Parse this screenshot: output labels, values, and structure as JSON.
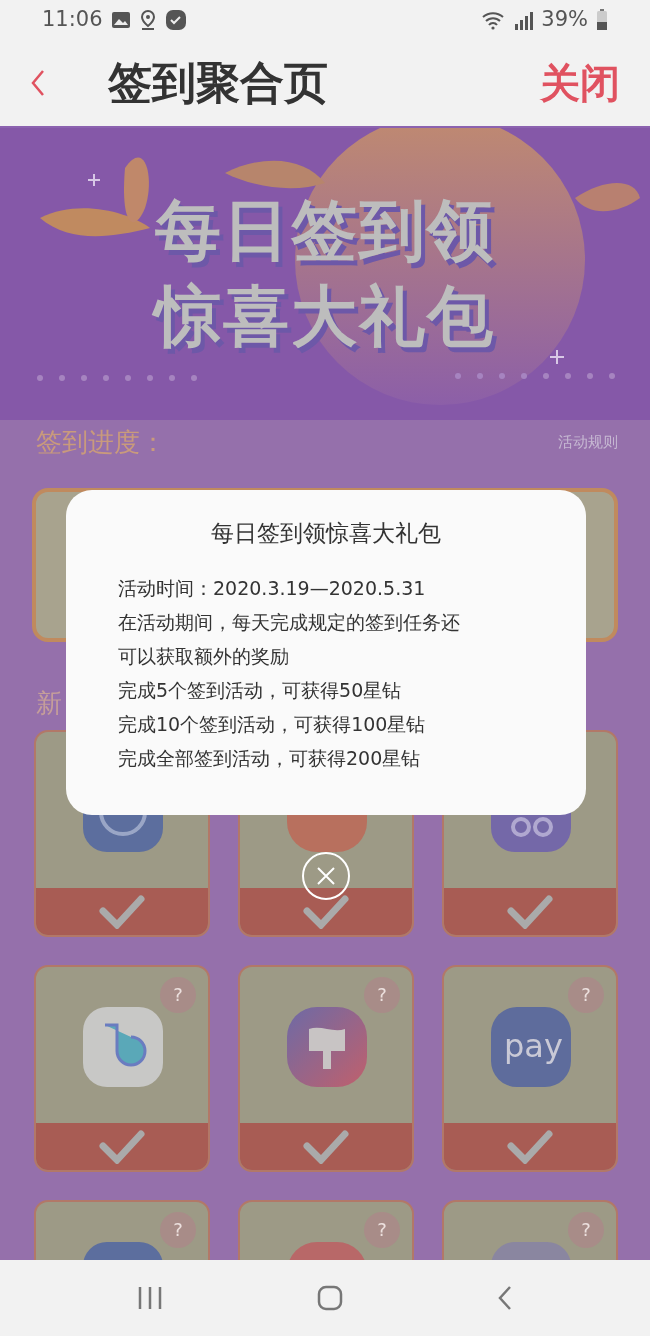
{
  "status_bar": {
    "time": "11:06",
    "battery": "39%"
  },
  "header": {
    "title": "签到聚合页",
    "close": "关闭"
  },
  "banner": {
    "title_lines": [
      "每日签到领",
      "惊喜大礼包"
    ]
  },
  "progress": {
    "label": "签到进度：",
    "rules_link": "活动规则"
  },
  "section_title": "新",
  "tasks": [
    {
      "done": true
    },
    {
      "done": true
    },
    {
      "done": true
    },
    {
      "done": true,
      "badge": "?"
    },
    {
      "done": true,
      "badge": "?"
    },
    {
      "done": true,
      "badge": "?",
      "icon_text": "pay"
    },
    {
      "badge": "?"
    },
    {
      "badge": "?"
    },
    {
      "badge": "?"
    }
  ],
  "dialog": {
    "title": "每日签到领惊喜大礼包",
    "lines": [
      "活动时间：2020.3.19—2020.5.31",
      "在活动期间，每天完成规定的签到任务还",
      "可以获取额外的奖励",
      "完成5个签到活动，可获得50星钻",
      "完成10个签到活动，可获得100星钻",
      "完成全部签到活动，可获得200星钻"
    ]
  }
}
